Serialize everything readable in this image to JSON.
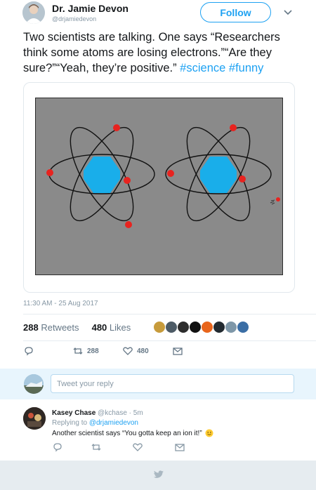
{
  "tweet": {
    "author_name": "Dr. Jamie Devon",
    "author_handle": "@drjamiedevon",
    "follow_label": "Follow",
    "text_main": "Two scientists are talking. One says “Researchers think some atoms are losing electrons.”“Are they sure?”“Yeah, they’re positive.” ",
    "hashtags": [
      "#science",
      "#funny"
    ],
    "timestamp": "11:30 AM - 25 Aug 2017",
    "retweet_count": "288",
    "retweet_label": "Retweets",
    "like_count": "480",
    "like_label": "Likes",
    "action_retweet_count": "288",
    "action_like_count": "480",
    "media_icon": "atom-illustration"
  },
  "reply_box": {
    "placeholder": "Tweet your reply"
  },
  "reply": {
    "name": "Kasey Chase",
    "handle": "@kchase",
    "separator": "·",
    "time": "5m",
    "replying_prefix": "Replying to",
    "replying_to": "@drjamiedevon",
    "text": "Another scientist says “You gotta keep an ion it!”"
  },
  "colors": {
    "accent": "#1da1f2",
    "text": "#14171a",
    "muted": "#8899a6",
    "nucleus": "#19aeea",
    "electron": "#e8231f",
    "canvas_bg": "#8a8a8a"
  },
  "icons": [
    "chevron-down-icon",
    "reply-icon",
    "retweet-icon",
    "heart-icon",
    "message-icon",
    "smile-emoji-icon",
    "twitter-bird-icon"
  ]
}
